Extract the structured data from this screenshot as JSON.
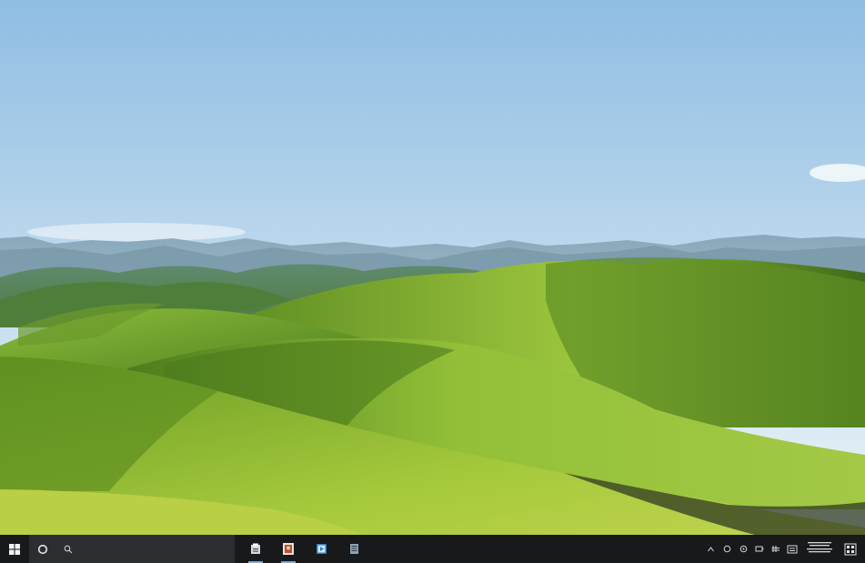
{
  "desktop": {
    "wallpaper": "rolling-green-hills",
    "colors": {
      "sky_top": "#9fc6e6",
      "sky_bottom": "#e6f1f7",
      "hill_green": "#7fae2f",
      "hill_shadow": "#3f6a1c"
    }
  },
  "taskbar": {
    "background": "#17191b",
    "start_icon": "windows-logo-icon",
    "search_icons": [
      "cortana-icon",
      "search-icon"
    ],
    "pinned": [
      {
        "name": "file-explorer-icon",
        "active": true
      },
      {
        "name": "photos-app-icon",
        "active": true
      },
      {
        "name": "media-player-icon",
        "active": false
      },
      {
        "name": "notepad-icon",
        "active": false
      }
    ],
    "tray": [
      "chevron-up-icon",
      "network-icon",
      "volume-icon",
      "battery-icon",
      "keyboard-icon",
      "language-icon"
    ],
    "clock": {
      "time": "",
      "date": ""
    }
  }
}
